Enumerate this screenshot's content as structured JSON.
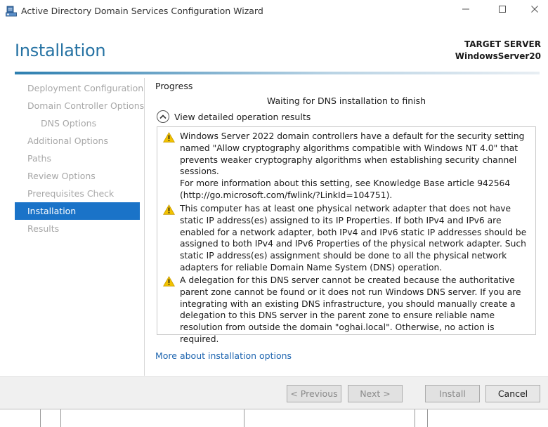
{
  "window": {
    "title": "Active Directory Domain Services Configuration Wizard",
    "icons": {
      "app": "server-wizard-icon",
      "minimize": "minimize-icon",
      "maximize": "maximize-icon",
      "close": "close-icon"
    }
  },
  "header": {
    "page_title": "Installation",
    "target_server_label": "TARGET SERVER",
    "target_server_name": "WindowsServer20"
  },
  "sidebar": {
    "items": [
      {
        "label": "Deployment Configuration",
        "state": "disabled"
      },
      {
        "label": "Domain Controller Options",
        "state": "disabled"
      },
      {
        "label": "DNS Options",
        "state": "disabled",
        "sub": true
      },
      {
        "label": "Additional Options",
        "state": "disabled"
      },
      {
        "label": "Paths",
        "state": "disabled"
      },
      {
        "label": "Review Options",
        "state": "disabled"
      },
      {
        "label": "Prerequisites Check",
        "state": "disabled"
      },
      {
        "label": "Installation",
        "state": "active"
      },
      {
        "label": "Results",
        "state": "disabled"
      }
    ]
  },
  "main": {
    "progress_label": "Progress",
    "status": "Waiting for DNS installation to finish",
    "details_toggle": "View detailed operation results",
    "messages": [
      {
        "icon": "warning-icon",
        "paragraphs": [
          "Windows Server 2022 domain controllers have a default for the security setting named \"Allow cryptography algorithms compatible with Windows NT 4.0\" that prevents weaker cryptography algorithms when establishing security channel sessions.",
          "For more information about this setting, see Knowledge Base article 942564 (http://go.microsoft.com/fwlink/?LinkId=104751)."
        ]
      },
      {
        "icon": "warning-icon",
        "paragraphs": [
          "This computer has at least one physical network adapter that does not have static IP address(es) assigned to its IP Properties. If both IPv4 and IPv6 are enabled for a network adapter, both IPv4 and IPv6 static IP addresses should be assigned to both IPv4 and IPv6 Properties of the physical network adapter. Such static IP address(es) assignment should be done to all the physical network adapters for reliable Domain Name System (DNS) operation."
        ]
      },
      {
        "icon": "warning-icon",
        "paragraphs": [
          "A delegation for this DNS server cannot be created because the authoritative parent zone cannot be found or it does not run Windows DNS server. If you are integrating with an existing DNS infrastructure, you should manually create a delegation to this DNS server in the parent zone to ensure reliable name resolution from outside the domain \"oghai.local\". Otherwise, no action is required."
        ]
      }
    ],
    "more_link": "More about installation options"
  },
  "footer": {
    "previous": "< Previous",
    "next": "Next >",
    "install": "Install",
    "cancel": "Cancel"
  },
  "colors": {
    "accent": "#2572a3",
    "nav_active": "#1a73c8",
    "link": "#1f66b0",
    "warning": "#f2c200"
  }
}
